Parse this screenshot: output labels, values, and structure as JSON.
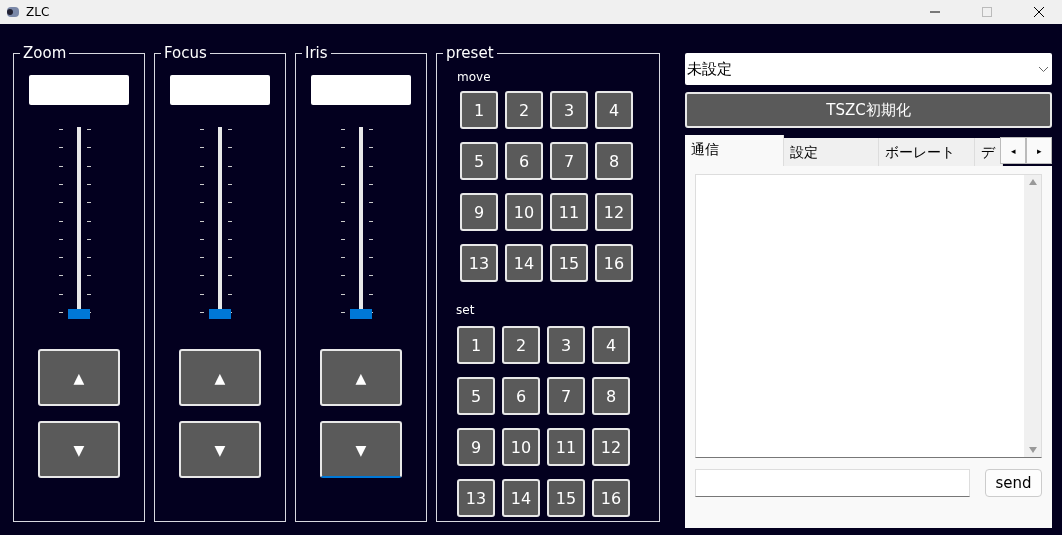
{
  "window": {
    "title": "ZLC"
  },
  "axes": [
    {
      "title": "Zoom",
      "level": 0,
      "up": "▲",
      "down": "▼",
      "down_focused": false
    },
    {
      "title": "Focus",
      "level": 0,
      "up": "▲",
      "down": "▼",
      "down_focused": false
    },
    {
      "title": "Iris",
      "level": 0,
      "up": "▲",
      "down": "▼",
      "down_focused": true
    }
  ],
  "preset": {
    "title": "preset",
    "move": {
      "label": "move",
      "buttons": [
        "1",
        "2",
        "3",
        "4",
        "5",
        "6",
        "7",
        "8",
        "9",
        "10",
        "11",
        "12",
        "13",
        "14",
        "15",
        "16"
      ]
    },
    "set": {
      "label": "set",
      "buttons": [
        "1",
        "2",
        "3",
        "4",
        "5",
        "6",
        "7",
        "8",
        "9",
        "10",
        "11",
        "12",
        "13",
        "14",
        "15",
        "16"
      ]
    }
  },
  "port_select": {
    "value": "未設定"
  },
  "init_button": "TSZC初期化",
  "tabs": [
    {
      "label": "通信",
      "selected": true
    },
    {
      "label": "設定",
      "selected": false
    },
    {
      "label": "ボーレート",
      "selected": false
    },
    {
      "label": "デ",
      "selected": false
    }
  ],
  "tab_scroll": [
    "◂",
    "▸"
  ],
  "send_button": "send"
}
